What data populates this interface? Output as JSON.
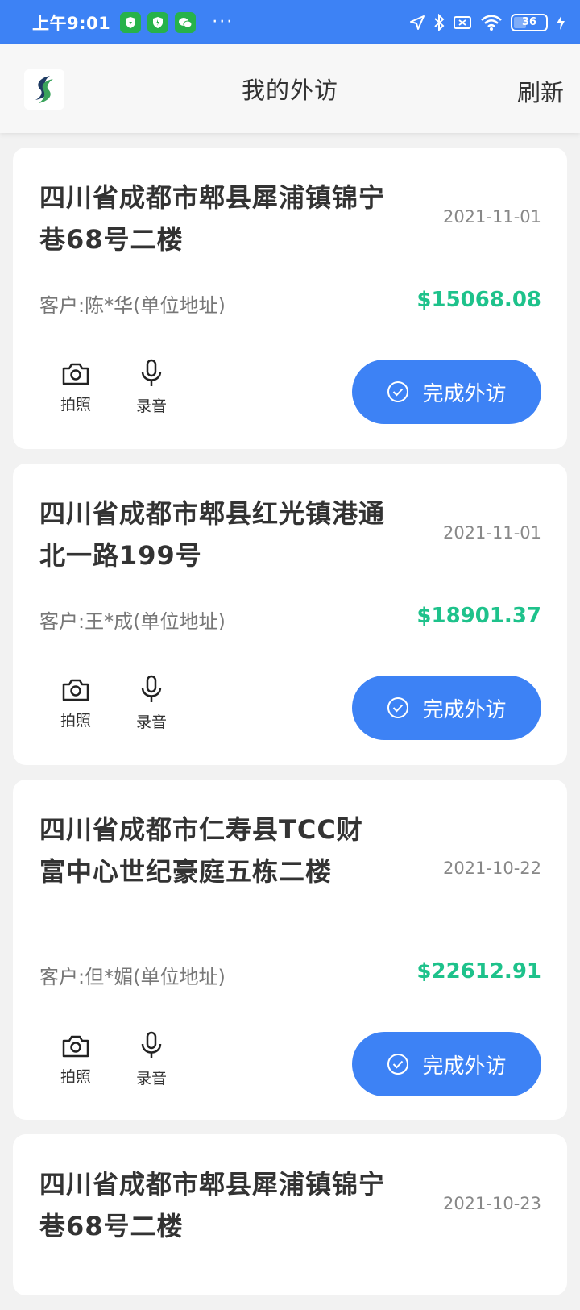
{
  "status_bar": {
    "time": "上午9:01",
    "dots": "···",
    "battery": "36"
  },
  "header": {
    "title": "我的外访",
    "refresh_label": "刷新"
  },
  "colors": {
    "primary": "#3d82f5",
    "amount_green": "#1ec28b"
  },
  "visits": [
    {
      "address": "四川省成都市郫县犀浦镇锦宁巷68号二楼",
      "date": "2021-11-01",
      "client": "客户:陈*华(单位地址)",
      "amount": "$15068.08"
    },
    {
      "address": "四川省成都市郫县红光镇港通北一路199号",
      "date": "2021-11-01",
      "client": "客户:王*成(单位地址)",
      "amount": "$18901.37"
    },
    {
      "address": "四川省成都市仁寿县TCC财富中心世纪豪庭五栋二楼",
      "date": "2021-10-22",
      "client": "客户:但*媚(单位地址)",
      "amount": "$22612.91"
    },
    {
      "address": "四川省成都市郫县犀浦镇锦宁巷68号二楼",
      "date": "2021-10-23"
    }
  ],
  "actions": {
    "photo_label": "拍照",
    "record_label": "录音",
    "finish_label": "完成外访"
  }
}
